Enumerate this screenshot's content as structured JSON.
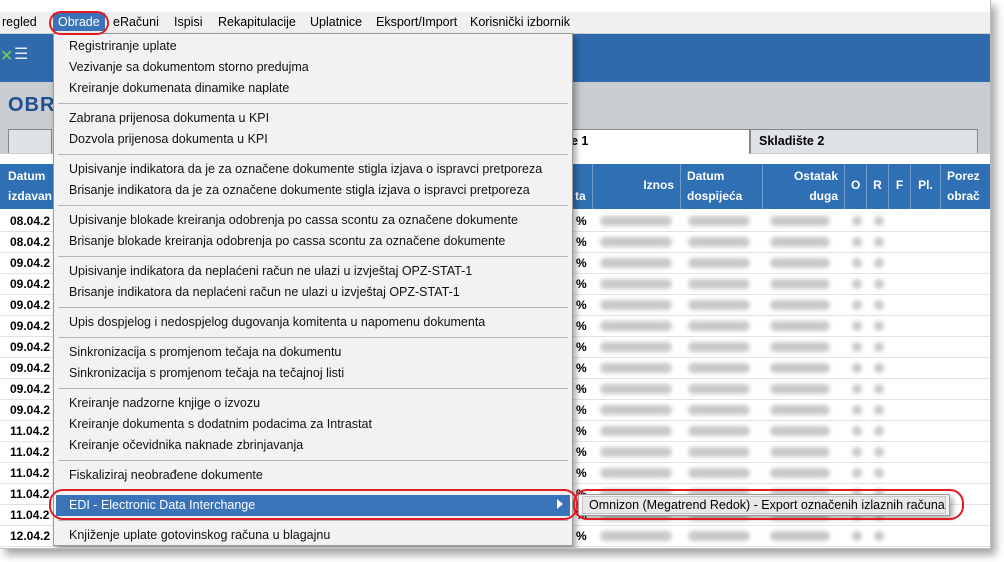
{
  "menubar": {
    "items": [
      "regled",
      "Obrade",
      "eRačuni",
      "Ispisi",
      "Rekapitulacije",
      "Uplatnice",
      "Eksport/Import",
      "Korisnički izbornik"
    ]
  },
  "page_title": "OBRA",
  "tabs": [
    "e 1",
    "Skladište 2"
  ],
  "grid": {
    "left_header": [
      "Datum",
      "izdavan"
    ],
    "headers": {
      "pct": "ta",
      "iznos": "Iznos",
      "datum_dospijeca": [
        "Datum",
        "dospijeća"
      ],
      "ostatak_duga": [
        "Ostatak",
        "duga"
      ],
      "o": "O",
      "r": "R",
      "f": "F",
      "pl": "Pl.",
      "porez": [
        "Porez",
        "obrač"
      ]
    },
    "dates": [
      "08.04.2",
      "08.04.2",
      "09.04.2",
      "09.04.2",
      "09.04.2",
      "09.04.2",
      "09.04.2",
      "09.04.2",
      "09.04.2",
      "09.04.2",
      "11.04.2",
      "11.04.2",
      "11.04.2",
      "11.04.2",
      "11.04.2",
      "12.04.2"
    ],
    "pct_values": [
      "%",
      "%",
      "%",
      "%",
      "%",
      "%",
      "%",
      "%",
      "%",
      "%",
      "%",
      "%",
      "%",
      "%",
      "%",
      "%"
    ]
  },
  "dropdown": {
    "groups": [
      [
        "Registriranje uplate",
        "Vezivanje sa dokumentom storno predujma",
        "Kreiranje dokumenata dinamike naplate"
      ],
      [
        "Zabrana prijenosa dokumenta u KPI",
        "Dozvola prijenosa dokumenta u KPI"
      ],
      [
        "Upisivanje indikatora da je za označene dokumente stigla izjava o ispravci pretporeza",
        "Brisanje indikatora da je za označene dokumente stigla izjava o ispravci pretporeza"
      ],
      [
        "Upisivanje blokade kreiranja odobrenja po cassa scontu za označene dokumente",
        "Brisanje blokade kreiranja odobrenja po cassa scontu za označene dokumente"
      ],
      [
        "Upisivanje indikatora da neplaćeni račun ne ulazi u izvještaj OPZ-STAT-1",
        "Brisanje indikatora da neplaćeni račun ne ulazi u izvještaj OPZ-STAT-1"
      ],
      [
        "Upis dospjelog i nedospjelog dugovanja komitenta u napomenu dokumenta"
      ],
      [
        "Sinkronizacija s promjenom tečaja na dokumentu",
        "Sinkronizacija s promjenom tečaja na tečajnoj listi"
      ],
      [
        "Kreiranje nadzorne knjige o izvozu",
        "Kreiranje dokumenta s dodatnim podacima za Intrastat",
        "Kreiranje očevidnika naknade zbrinjavanja"
      ],
      [
        "Fiskaliziraj neobrađene dokumente"
      ]
    ],
    "edi_item": "EDI - Electronic Data Interchange",
    "last_item": "Knjiženje uplate gotovinskog računa u blagajnu"
  },
  "submenu": {
    "item": "Omnizon (Megatrend Redok) - Export označenih izlaznih računa"
  },
  "colors": {
    "accent": "#3b73b9",
    "toolbar": "#2e6aac",
    "header": "#2f6fb3",
    "highlight": "#e01b24"
  }
}
